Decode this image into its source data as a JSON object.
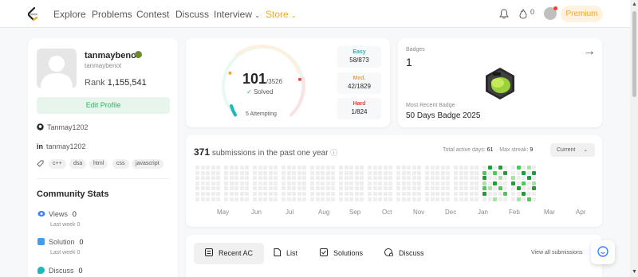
{
  "nav": {
    "items": [
      "Explore",
      "Problems",
      "Contest",
      "Discuss",
      "Interview",
      "Store"
    ],
    "notifications": "0",
    "premium": "Premium"
  },
  "profile": {
    "name": "tanmaybenot",
    "username": "tanmaybenot",
    "rank_label": "Rank",
    "rank_value": "1,155,541",
    "edit_label": "Edit Profile",
    "github": "Tanmay1202",
    "linkedin": "tanmay1202",
    "tags": [
      "c++",
      "dsa",
      "html",
      "css",
      "javascript"
    ]
  },
  "community": {
    "title": "Community Stats",
    "views": {
      "label": "Views",
      "value": "0",
      "sub": "Last week 0"
    },
    "solution": {
      "label": "Solution",
      "value": "0",
      "sub": "Last week 0"
    },
    "discuss": {
      "label": "Discuss",
      "value": "0"
    }
  },
  "solved": {
    "count": "101",
    "total": "/3526",
    "label": "Solved",
    "attempting": "5 Attempting",
    "easy": {
      "label": "Easy",
      "value": "58/873"
    },
    "medium": {
      "label": "Med.",
      "value": "42/1829"
    },
    "hard": {
      "label": "Hard",
      "value": "1/824"
    }
  },
  "badges": {
    "title": "Badges",
    "count": "1",
    "recent_label": "Most Recent Badge",
    "recent_name": "50 Days Badge 2025"
  },
  "heatmap": {
    "count": "371",
    "text": "submissions in the past one year",
    "active_days_label": "Total active days:",
    "active_days": "61",
    "max_streak_label": "Max streak:",
    "max_streak": "9",
    "period": "Current",
    "months": [
      "May",
      "Jun",
      "Jul",
      "Aug",
      "Sep",
      "Oct",
      "Nov",
      "Dec",
      "Jan",
      "Feb",
      "Mar",
      "Apr"
    ]
  },
  "tabs": {
    "recent": "Recent AC",
    "list": "List",
    "solutions": "Solutions",
    "discuss": "Discuss",
    "view_all": "View all submissions"
  },
  "colors": {
    "easy": "#1cbaba",
    "medium": "#f5a623",
    "hard": "#ef4743",
    "green": "#2db55d",
    "accent": "#f5a623"
  }
}
